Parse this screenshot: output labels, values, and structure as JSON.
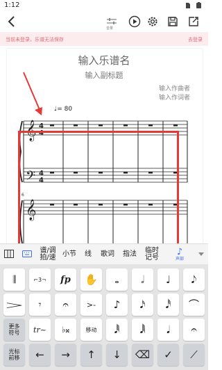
{
  "status_bar": {
    "time": "1:12"
  },
  "toolbar": {
    "mixer_label": "音量",
    "icons": [
      "back-arrow-icon",
      "mixer-icon",
      "play-icon",
      "settings-gear-icon",
      "save-icon",
      "export-icon"
    ]
  },
  "warning": {
    "message": "当前未登录，乐谱无法保存",
    "login_label": "去登录"
  },
  "score": {
    "title": "输入乐谱名",
    "subtitle": "输入副标题",
    "composer_1": "输入作曲者",
    "composer_2": "输入作词者",
    "tempo": "♩= 80",
    "time_signature": "4/4",
    "bar_number": "6"
  },
  "mode_bar": {
    "items": [
      {
        "label": "",
        "icon": "piano-keys-icon"
      },
      {
        "label": "",
        "icon": "keyboard-icon"
      },
      {
        "label": "谱/调\n拍/速"
      },
      {
        "label": "小节"
      },
      {
        "label": "线"
      },
      {
        "label": "歌词"
      },
      {
        "label": "指法"
      },
      {
        "label": "临时\n记号"
      },
      {
        "label": "声部",
        "icon": "voice-note-icon"
      }
    ],
    "active_index": 8,
    "active_color": "#3b6cf6"
  },
  "keyboard": {
    "row1": [
      "𝄂",
      "⌐3¬",
      "fp",
      "✋",
      "𝅝",
      "𝅗𝅥",
      "♩",
      "𝅘𝅥𝅮"
    ],
    "row2": [
      "𝆓",
      "𝄾",
      "𝄐",
      ">-",
      "♪",
      "𝅘𝅥𝅯",
      "𝅘𝅥𝅰",
      "⌒"
    ],
    "row3": [
      "更多\n符号",
      "tr~",
      "♭𝄪",
      "移动",
      "𝅘𝅥𝅱",
      "𝅘𝅥𝅲",
      "𝅘𝅥",
      "𝄐"
    ],
    "row4": [
      "光标\n前移",
      "←",
      "→",
      "↑",
      "↓",
      "⌫",
      "✓",
      "⟋"
    ]
  },
  "colors": {
    "warning_bg": "#fdecee",
    "warning_text": "#e06a76",
    "annotation_red": "#e53935",
    "accent_blue": "#3b6cf6"
  }
}
